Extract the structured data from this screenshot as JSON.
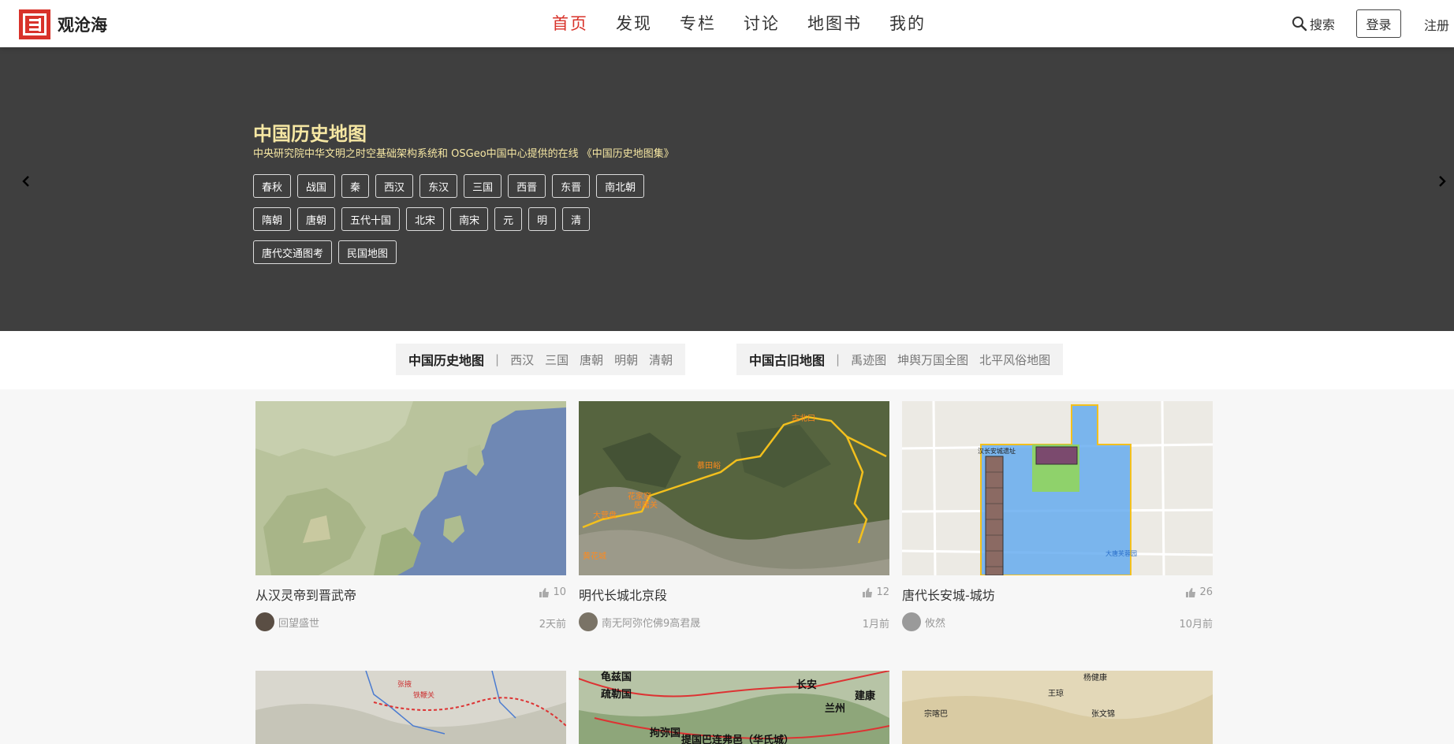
{
  "header": {
    "site_name": "观沧海",
    "nav": [
      "首页",
      "发现",
      "专栏",
      "讨论",
      "地图书",
      "我的"
    ],
    "search_label": "搜索",
    "login_label": "登录",
    "register_label": "注册"
  },
  "banner": {
    "title": "中国历史地图",
    "subtitle": "中央研究院中华文明之时空基础架构系统和 OSGeo中国中心提供的在线 《中国历史地图集》",
    "tag_rows": [
      [
        "春秋",
        "战国",
        "秦",
        "西汉",
        "东汉",
        "三国",
        "西晋",
        "东晋",
        "南北朝"
      ],
      [
        "隋朝",
        "唐朝",
        "五代十国",
        "北宋",
        "南宋",
        "元",
        "明",
        "清"
      ],
      [
        "唐代交通图考",
        "民国地图"
      ]
    ]
  },
  "quickbar": {
    "history": {
      "title": "中国历史地图",
      "links": [
        "西汉",
        "三国",
        "唐朝",
        "明朝",
        "清朝"
      ]
    },
    "ancient": {
      "title": "中国古旧地图",
      "links": [
        "禹迹图",
        "坤舆万国全图",
        "北平风俗地图"
      ]
    }
  },
  "cards": [
    {
      "title": "从汉灵帝到晋武帝",
      "likes": "10",
      "author": "回望盛世",
      "time": "2天前"
    },
    {
      "title": "明代长城北京段",
      "likes": "12",
      "author": "南无阿弥佗佛9高君晟",
      "time": "1月前"
    },
    {
      "title": "唐代长安城-城坊",
      "likes": "26",
      "author": "攸然",
      "time": "10月前"
    }
  ],
  "map_labels": {
    "card2": [
      "居庸关",
      "花家窑",
      "大营盘",
      "慕田峪",
      "黄花城",
      "古北口"
    ],
    "card3": [
      "汉长安城遗址",
      "大唐芙蓉园"
    ],
    "row2_left": [
      "张掖",
      "铁鞭关"
    ],
    "row2_mid": [
      "龟兹国",
      "疏勒国",
      "长安",
      "兰州",
      "建康",
      "拘弥国",
      "提国巴连弗邑（华氏城）"
    ],
    "row2_right": [
      "杨健康",
      "王琼",
      "张文锦",
      "宗喀巴"
    ]
  },
  "colors": {
    "accent": "#d8322a",
    "banner_bg": "#3f3f3f",
    "banner_text": "#f6e7a3"
  }
}
